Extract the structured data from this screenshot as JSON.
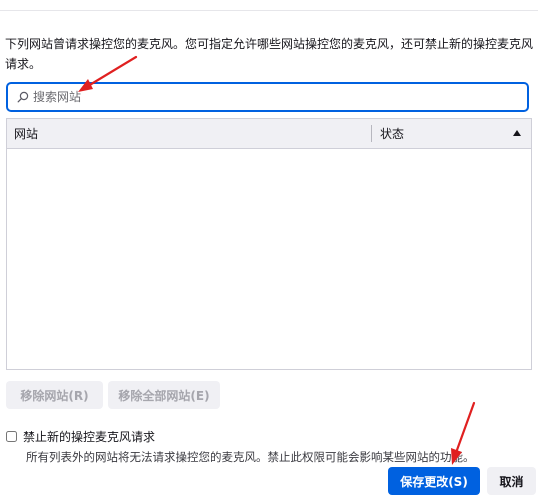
{
  "description": "下列网站曾请求操控您的麦克风。您可指定允许哪些网站操控您的麦克风，还可禁止新的操控麦克风请求。",
  "search": {
    "icon": "search-icon",
    "placeholder": "搜索网站",
    "value": ""
  },
  "table": {
    "columns": [
      "网站",
      "状态"
    ],
    "sort_icon": "sort-ascending-icon",
    "rows": []
  },
  "buttons": {
    "remove_site": "移除网站(R)",
    "remove_all_sites": "移除全部网站(E)",
    "save_changes": "保存更改(S)",
    "cancel": "取消"
  },
  "block_new_requests": {
    "label": "禁止新的操控麦克风请求",
    "checked": false,
    "hint": "所有列表外的网站将无法请求操控您的麦克风。禁止此权限可能会影响某些网站的功能。"
  },
  "colors": {
    "accent": "#0061e0",
    "annotation_arrow": "#e02020"
  }
}
